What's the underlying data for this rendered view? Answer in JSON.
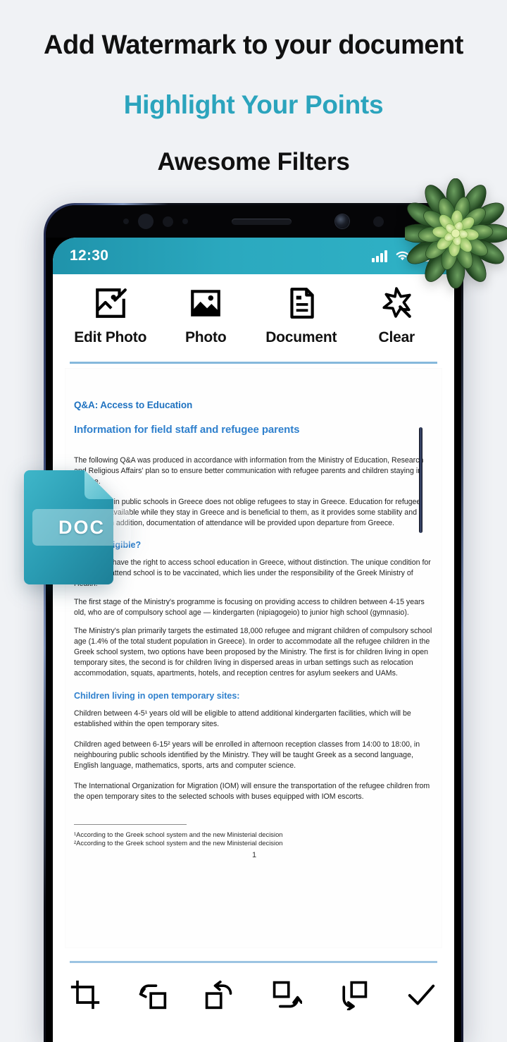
{
  "promo": {
    "line1": "Add Watermark to your document",
    "line2": "Highlight Your Points",
    "line3": "Awesome Filters",
    "accent_color": "#2ba4bd",
    "heading_color": "#111111"
  },
  "statusbar": {
    "time": "12:30",
    "background_color": "#2ba9bf",
    "signal_icon": "signal-bars-icon",
    "wifi_icon": "wifi-icon",
    "battery_icon": "battery-icon"
  },
  "toolbar_top": {
    "items": [
      {
        "label": "Edit Photo",
        "icon": "edit-photo-icon"
      },
      {
        "label": "Photo",
        "icon": "photo-icon"
      },
      {
        "label": "Document",
        "icon": "document-icon"
      },
      {
        "label": "Clear",
        "icon": "magic-wand-icon"
      }
    ]
  },
  "toolbar_bottom": {
    "items": [
      {
        "name": "crop",
        "icon": "crop-icon"
      },
      {
        "name": "rotate-left",
        "icon": "rotate-left-icon"
      },
      {
        "name": "rotate-right",
        "icon": "rotate-right-icon"
      },
      {
        "name": "flip-vertical",
        "icon": "flip-vertical-icon"
      },
      {
        "name": "flip-horizontal",
        "icon": "flip-horizontal-icon"
      },
      {
        "name": "confirm",
        "icon": "checkmark-icon"
      }
    ]
  },
  "doc_badge": {
    "label": "DOC",
    "color": "#2a9cb3"
  },
  "document": {
    "heading1": "Q&A: Access to Education",
    "heading2": "Information for field staff and refugee parents",
    "paragraphs": [
      "The following Q&A was produced in accordance with information from the Ministry of Education, Research and Religious Affairs' plan so to ensure better communication with refugee parents and children staying in Greece.",
      "Attendance in public schools in Greece does not oblige refugees to stay in Greece. Education for refugee children is available while they stay in Greece and is beneficial to them, as it provides some stability and normality. In addition, documentation of attendance will be provided upon departure from Greece."
    ],
    "section1_heading": "Who is eligible?",
    "section1_paragraphs": [
      "All children have the right to access school education in Greece, without distinction. The unique condition for children to attend school is to be vaccinated, which lies under the responsibility of the Greek Ministry of Health.",
      "The first stage of the Ministry's programme is focusing on providing access to children between 4-15 years old, who are of compulsory school age — kindergarten (nipiagogeio) to junior high school (gymnasio).",
      "The Ministry's plan primarily targets the estimated 18,000 refugee and migrant children of compulsory school age (1.4% of the total student population in Greece). In order to accommodate all the refugee children in the Greek school system, two options have been proposed by the Ministry. The first is for children living in open temporary sites, the second is for children living in dispersed areas in urban settings such as relocation accommodation, squats, apartments, hotels, and reception centres for asylum seekers and UAMs."
    ],
    "section2_heading": "Children living in open temporary sites:",
    "section2_paragraphs": [
      "Children between 4-5¹ years old will be eligible to attend additional kindergarten facilities, which will be established within the open temporary sites.",
      "Children aged between 6-15² years will be enrolled in afternoon reception classes from 14:00 to 18:00, in neighbouring public schools identified by the Ministry. They will be taught Greek as a second language, English language, mathematics, sports, arts and computer science.",
      "The International Organization for Migration (IOM) will ensure the transportation of the refugee children from the open temporary sites to the selected schools with buses equipped with IOM escorts."
    ],
    "footnotes": [
      "¹According to the Greek school system and the new Ministerial decision",
      "²According to the Greek school system and the new Ministerial decision"
    ],
    "page_number": "1",
    "heading_color": "#2f80cd"
  }
}
